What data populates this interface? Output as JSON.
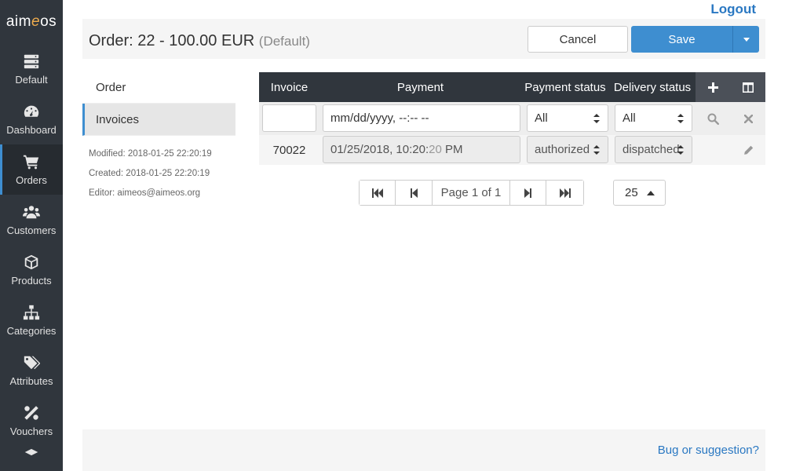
{
  "app": {
    "logo_a": "aim",
    "logo_e": "e",
    "logo_b": "os"
  },
  "sidebar": {
    "items": [
      {
        "label": "Default",
        "icon": "server-icon"
      },
      {
        "label": "Dashboard",
        "icon": "dashboard-icon"
      },
      {
        "label": "Orders",
        "icon": "cart-icon",
        "active": true
      },
      {
        "label": "Customers",
        "icon": "users-icon"
      },
      {
        "label": "Products",
        "icon": "cube-icon"
      },
      {
        "label": "Categories",
        "icon": "sitemap-icon"
      },
      {
        "label": "Attributes",
        "icon": "tags-icon"
      },
      {
        "label": "Vouchers",
        "icon": "percent-icon"
      }
    ]
  },
  "topbar": {
    "logout": "Logout"
  },
  "header": {
    "title": "Order: 22 - 100.00 EUR",
    "site": "(Default)",
    "cancel_label": "Cancel",
    "save_label": "Save"
  },
  "subnav": {
    "items": [
      {
        "label": "Order"
      },
      {
        "label": "Invoices",
        "active": true
      }
    ],
    "modified": "Modified: 2018-01-25 22:20:19",
    "created": "Created: 2018-01-25 22:20:19",
    "editor": "Editor: aimeos@aimeos.org"
  },
  "table": {
    "headers": {
      "invoice": "Invoice",
      "payment": "Payment",
      "payment_status": "Payment status",
      "delivery_status": "Delivery status"
    },
    "filter": {
      "invoice": "",
      "payment_placeholder": "mm/dd/yyyy, --:-- --",
      "payment_status": "All",
      "delivery_status": "All"
    },
    "rows": [
      {
        "invoice": "70022",
        "payment_date": "01/25/2018,",
        "payment_hm": "10:20:",
        "payment_sec": "20",
        "payment_ampm": "PM",
        "payment_status": "authorized",
        "delivery_status": "dispatched"
      }
    ]
  },
  "pagination": {
    "page_text": "Page 1 of 1",
    "per_page": "25"
  },
  "footer": {
    "bug_link": "Bug or suggestion?"
  },
  "colors": {
    "sidebar_bg": "#30363d",
    "accent": "#3e8ed0",
    "link": "#2a78c2"
  }
}
